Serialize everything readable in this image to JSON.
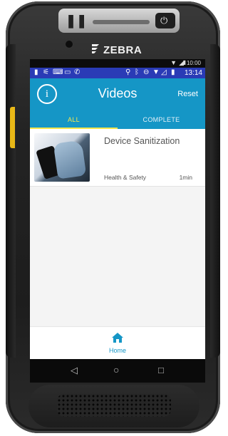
{
  "device": {
    "brand": "ZEBRA",
    "side_key_color": "#e8b817"
  },
  "status_top": {
    "time": "10:00",
    "icons": [
      "signal-icon",
      "battery-icon"
    ]
  },
  "status_main": {
    "left_icons": [
      "person-icon",
      "wifi-scan-icon",
      "keyboard-icon",
      "cast-icon",
      "phone-icon"
    ],
    "right_icons": [
      "location-icon",
      "bluetooth-icon",
      "do-not-disturb-icon",
      "wifi-icon",
      "no-signal-icon",
      "battery-icon"
    ],
    "time": "13:14"
  },
  "appbar": {
    "info_glyph": "i",
    "title": "Videos",
    "reset_label": "Reset",
    "color": "#1596c6"
  },
  "tabs": {
    "all_label": "ALL",
    "complete_label": "COMPLETE",
    "active": "ALL",
    "active_color": "#f6e74c"
  },
  "videos": [
    {
      "title": "Device Sanitization",
      "category": "Health & Safety",
      "duration": "1min"
    }
  ],
  "bottom_nav": {
    "home_label": "Home"
  },
  "android_nav": {
    "back": "◁",
    "home": "○",
    "recents": "□"
  }
}
